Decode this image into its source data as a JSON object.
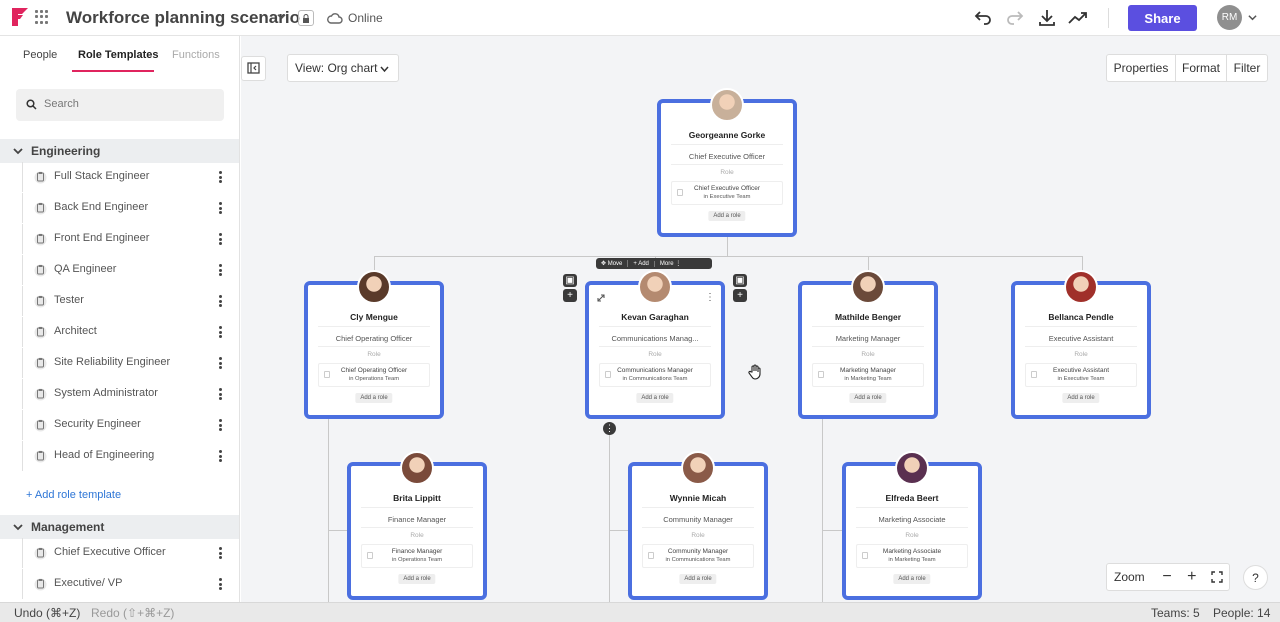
{
  "header": {
    "title": "Workforce planning scenario",
    "status": "Online",
    "share_label": "Share",
    "user_initials": "RM",
    "accent": "#5b4fe0"
  },
  "sidebar": {
    "tabs": [
      {
        "label": "People"
      },
      {
        "label": "Role Templates"
      },
      {
        "label": "Functions"
      }
    ],
    "search_placeholder": "Search",
    "groups": [
      {
        "label": "Engineering",
        "items": [
          "Full Stack Engineer",
          "Back End Engineer",
          "Front End Engineer",
          "QA Engineer",
          "Tester",
          "Architect",
          "Site Reliability Engineer",
          "System Administrator",
          "Security Engineer",
          "Head of Engineering"
        ],
        "add_label": "+ Add role template"
      },
      {
        "label": "Management",
        "items": [
          "Chief Executive Officer",
          "Executive/ VP"
        ]
      }
    ]
  },
  "toolbar": {
    "view_label": "View: Org chart",
    "properties": "Properties",
    "format": "Format",
    "filter": "Filter"
  },
  "card_role_label": "Role",
  "card_add_role": "Add a role",
  "action_bar": {
    "move": "Move",
    "add": "+ Add",
    "more": "More"
  },
  "cards": [
    {
      "name": "Georgeanne Gorke",
      "title": "Chief Executive Officer",
      "role": "Chief Executive Officer",
      "team": "in Executive Team"
    },
    {
      "name": "Cly Mengue",
      "title": "Chief Operating Officer",
      "role": "Chief Operating Officer",
      "team": "in Operations Team"
    },
    {
      "name": "Kevan Garaghan",
      "title": "Communications Manag...",
      "role": "Communications Manager",
      "team": "in Communications Team"
    },
    {
      "name": "Mathilde Benger",
      "title": "Marketing Manager",
      "role": "Marketing Manager",
      "team": "in Marketing Team"
    },
    {
      "name": "Bellanca Pendle",
      "title": "Executive Assistant",
      "role": "Executive Assistant",
      "team": "in Executive Team"
    },
    {
      "name": "Brita Lippitt",
      "title": "Finance Manager",
      "role": "Finance Manager",
      "team": "in Operations Team"
    },
    {
      "name": "Wynnie Micah",
      "title": "Community Manager",
      "role": "Community Manager",
      "team": "in Communications Team"
    },
    {
      "name": "Elfreda Beert",
      "title": "Marketing Associate",
      "role": "Marketing Associate",
      "team": "in Marketing Team"
    }
  ],
  "zoom": {
    "label": "Zoom",
    "minus": "−",
    "plus": "+",
    "help": "?"
  },
  "status": {
    "undo": "Undo (⌘+Z)",
    "redo": "Redo (⇧+⌘+Z)",
    "teams": "Teams: 5",
    "people": "People: 14"
  }
}
